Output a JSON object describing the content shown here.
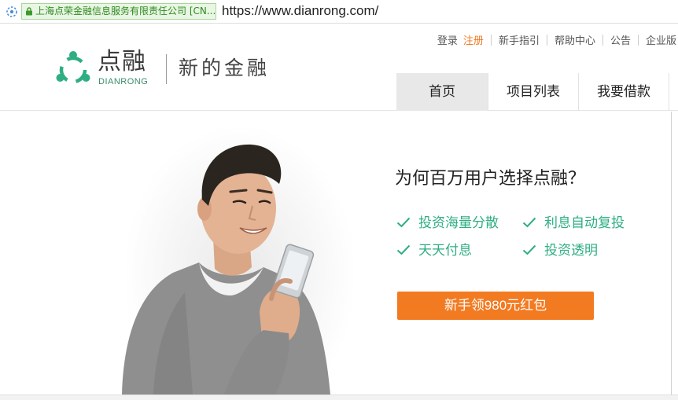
{
  "browser": {
    "cert_label": "上海点荣金融信息服务有限责任公司 [CN...",
    "url_scheme": "https://www.",
    "url_host": "dianrong.com",
    "url_path": "/"
  },
  "toplinks": {
    "login": "登录",
    "register": "注册",
    "guide": "新手指引",
    "help": "帮助中心",
    "notice": "公告",
    "enterprise": "企业版"
  },
  "logo": {
    "name_cn": "点融",
    "name_en": "DIANRONG",
    "slogan": "新的金融"
  },
  "nav": {
    "items": [
      "首页",
      "项目列表",
      "我要借款"
    ]
  },
  "hero": {
    "title": "为何百万用户选择点融？",
    "features": [
      "投资海量分散",
      "利息自动复投",
      "天天付息",
      "投资透明"
    ],
    "cta": "新手领980元红包"
  },
  "colors": {
    "brand_green": "#2fae83",
    "cta_orange": "#f27a21",
    "register_orange": "#f07a22",
    "nav_active_bg": "#e8e8e8"
  }
}
